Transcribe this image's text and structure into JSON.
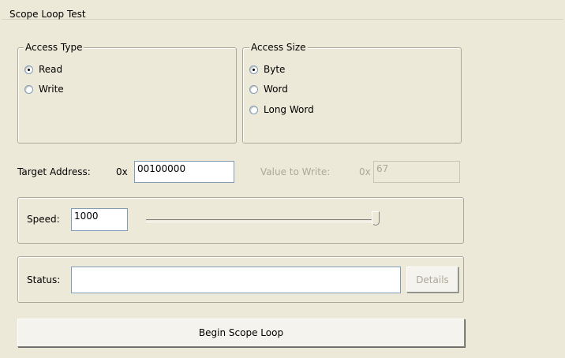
{
  "tab": {
    "title": "Scope Loop Test"
  },
  "access_type": {
    "legend": "Access Type",
    "options": [
      {
        "label": "Read",
        "selected": true
      },
      {
        "label": "Write",
        "selected": false
      }
    ]
  },
  "access_size": {
    "legend": "Access Size",
    "options": [
      {
        "label": "Byte",
        "selected": true
      },
      {
        "label": "Word",
        "selected": false
      },
      {
        "label": "Long Word",
        "selected": false
      }
    ]
  },
  "target_address": {
    "label": "Target Address:",
    "prefix": "0x",
    "value": "00100000"
  },
  "value_to_write": {
    "label": "Value to Write:",
    "prefix": "0x",
    "value": "67",
    "enabled": false
  },
  "speed": {
    "label": "Speed:",
    "value": "1000",
    "slider_fraction": 1.0
  },
  "status": {
    "label": "Status:",
    "value": "",
    "details_label": "Details"
  },
  "begin_button": {
    "label": "Begin Scope Loop"
  },
  "colors": {
    "background": "#ece9d8",
    "border": "#aca899",
    "field_border": "#7f9db9",
    "disabled_text": "#aca899"
  }
}
